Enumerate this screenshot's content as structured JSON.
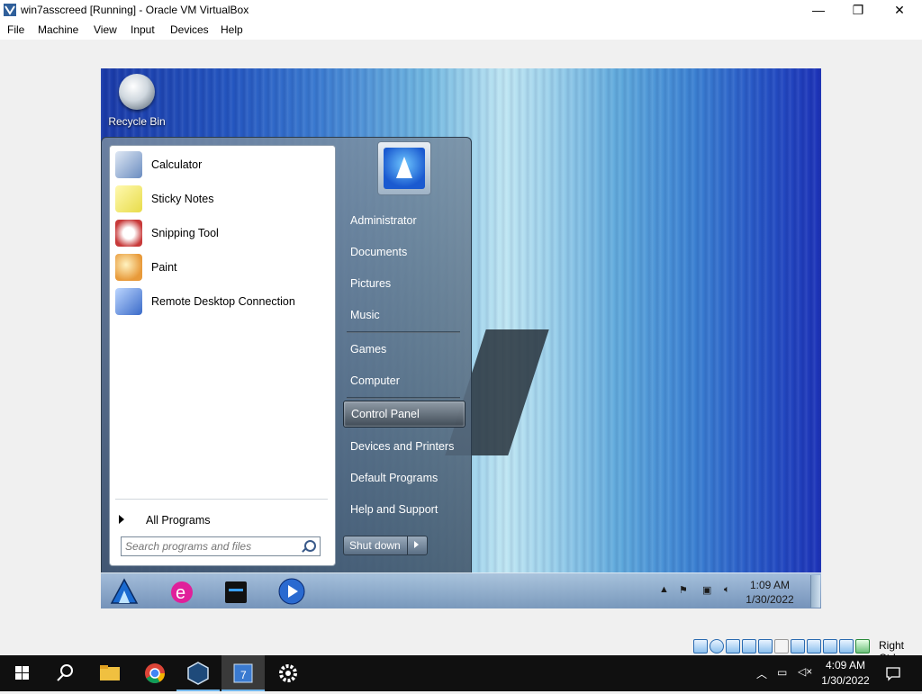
{
  "window": {
    "title": "win7asscreed [Running] - Oracle VM VirtualBox",
    "controls": {
      "minimize": "—",
      "restore": "❐",
      "close": "✕"
    }
  },
  "menubar": {
    "items": [
      "File",
      "Machine",
      "View",
      "Input",
      "Devices",
      "Help"
    ]
  },
  "desktop": {
    "recycle_bin_label": "Recycle Bin"
  },
  "startmenu": {
    "programs": [
      {
        "label": "Calculator",
        "icon": "calculator-icon",
        "color": "#6a8cc0"
      },
      {
        "label": "Sticky Notes",
        "icon": "sticky-notes-icon",
        "color": "#e8dc4a"
      },
      {
        "label": "Snipping Tool",
        "icon": "snipping-tool-icon",
        "color": "#c83a3a"
      },
      {
        "label": "Paint",
        "icon": "paint-icon",
        "color": "#e89a3a"
      },
      {
        "label": "Remote Desktop Connection",
        "icon": "remote-desktop-icon",
        "color": "#3a6ac8"
      }
    ],
    "all_programs": "All Programs",
    "search_placeholder": "Search programs and files",
    "right_items": {
      "administrator": "Administrator",
      "documents": "Documents",
      "pictures": "Pictures",
      "music": "Music",
      "games": "Games",
      "computer": "Computer",
      "control_panel": "Control Panel",
      "devices_printers": "Devices and Printers",
      "default_programs": "Default Programs",
      "help_support": "Help and Support"
    },
    "shutdown_label": "Shut down"
  },
  "guest_taskbar": {
    "time": "1:09 AM",
    "date": "1/30/2022"
  },
  "statusbar": {
    "host_key": "Right Ctrl"
  },
  "host_taskbar": {
    "time": "4:09 AM",
    "date": "1/30/2022"
  }
}
